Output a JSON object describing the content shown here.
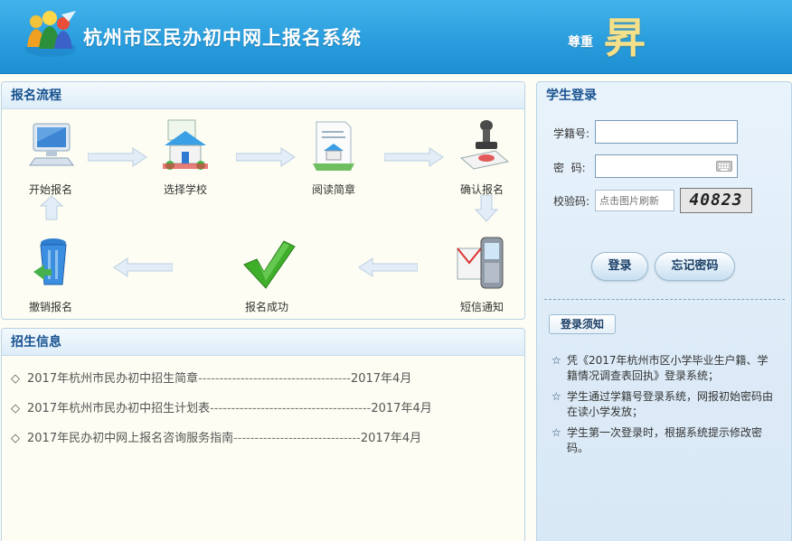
{
  "header": {
    "title": "杭州市区民办初中网上报名系统",
    "slogan_small": "尊重",
    "slogan_big": "昇"
  },
  "flow": {
    "title": "报名流程",
    "steps": [
      {
        "label": "开始报名",
        "icon": "computer-icon"
      },
      {
        "label": "选择学校",
        "icon": "school-icon"
      },
      {
        "label": "阅读简章",
        "icon": "document-icon"
      },
      {
        "label": "确认报名",
        "icon": "stamp-icon"
      },
      {
        "label": "短信通知",
        "icon": "phone-message-icon"
      },
      {
        "label": "报名成功",
        "icon": "checkmark-icon"
      },
      {
        "label": "撤销报名",
        "icon": "recycle-bin-icon"
      }
    ]
  },
  "news": {
    "title": "招生信息",
    "items": [
      {
        "bullet": "◇",
        "text": "2017年杭州市民办初中招生简章",
        "dash": "------------------------------------",
        "date": "2017年4月"
      },
      {
        "bullet": "◇",
        "text": "2017年杭州市民办初中招生计划表",
        "dash": "--------------------------------------",
        "date": "2017年4月"
      },
      {
        "bullet": "◇",
        "text": "2017年民办初中网上报名咨询服务指南",
        "dash": "------------------------------",
        "date": "2017年4月"
      }
    ]
  },
  "login": {
    "title": "学生登录",
    "student_id_label": "学籍号:",
    "student_id_value": "",
    "password_label": "密  码:",
    "password_value": "",
    "captcha_label": "校验码:",
    "captcha_placeholder": "点击图片刷新",
    "captcha_text": "40823",
    "login_button": "登录",
    "forgot_button": "忘记密码",
    "notice_button": "登录须知",
    "notices": [
      {
        "star": "☆",
        "text": "凭《2017年杭州市区小学毕业生户籍、学籍情况调查表回执》登录系统；"
      },
      {
        "star": "☆",
        "text": "学生通过学籍号登录系统，网报初始密码由在读小学发放；"
      },
      {
        "star": "☆",
        "text": "学生第一次登录时，根据系统提示修改密码。"
      }
    ]
  },
  "colors": {
    "header_blue": "#2a9ede",
    "panel_title": "#16518f",
    "check_green": "#3fae2a"
  }
}
